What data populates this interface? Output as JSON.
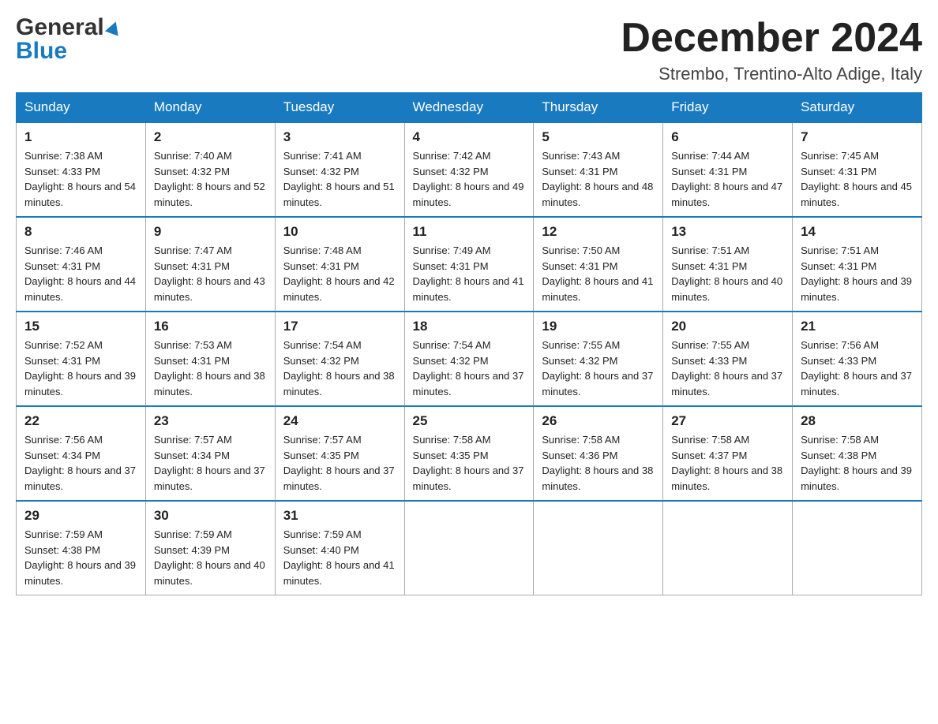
{
  "header": {
    "logo_general": "General",
    "logo_blue": "Blue",
    "month_title": "December 2024",
    "location": "Strembo, Trentino-Alto Adige, Italy"
  },
  "days_of_week": [
    "Sunday",
    "Monday",
    "Tuesday",
    "Wednesday",
    "Thursday",
    "Friday",
    "Saturday"
  ],
  "weeks": [
    [
      {
        "day": "1",
        "sunrise": "7:38 AM",
        "sunset": "4:33 PM",
        "daylight": "8 hours and 54 minutes."
      },
      {
        "day": "2",
        "sunrise": "7:40 AM",
        "sunset": "4:32 PM",
        "daylight": "8 hours and 52 minutes."
      },
      {
        "day": "3",
        "sunrise": "7:41 AM",
        "sunset": "4:32 PM",
        "daylight": "8 hours and 51 minutes."
      },
      {
        "day": "4",
        "sunrise": "7:42 AM",
        "sunset": "4:32 PM",
        "daylight": "8 hours and 49 minutes."
      },
      {
        "day": "5",
        "sunrise": "7:43 AM",
        "sunset": "4:31 PM",
        "daylight": "8 hours and 48 minutes."
      },
      {
        "day": "6",
        "sunrise": "7:44 AM",
        "sunset": "4:31 PM",
        "daylight": "8 hours and 47 minutes."
      },
      {
        "day": "7",
        "sunrise": "7:45 AM",
        "sunset": "4:31 PM",
        "daylight": "8 hours and 45 minutes."
      }
    ],
    [
      {
        "day": "8",
        "sunrise": "7:46 AM",
        "sunset": "4:31 PM",
        "daylight": "8 hours and 44 minutes."
      },
      {
        "day": "9",
        "sunrise": "7:47 AM",
        "sunset": "4:31 PM",
        "daylight": "8 hours and 43 minutes."
      },
      {
        "day": "10",
        "sunrise": "7:48 AM",
        "sunset": "4:31 PM",
        "daylight": "8 hours and 42 minutes."
      },
      {
        "day": "11",
        "sunrise": "7:49 AM",
        "sunset": "4:31 PM",
        "daylight": "8 hours and 41 minutes."
      },
      {
        "day": "12",
        "sunrise": "7:50 AM",
        "sunset": "4:31 PM",
        "daylight": "8 hours and 41 minutes."
      },
      {
        "day": "13",
        "sunrise": "7:51 AM",
        "sunset": "4:31 PM",
        "daylight": "8 hours and 40 minutes."
      },
      {
        "day": "14",
        "sunrise": "7:51 AM",
        "sunset": "4:31 PM",
        "daylight": "8 hours and 39 minutes."
      }
    ],
    [
      {
        "day": "15",
        "sunrise": "7:52 AM",
        "sunset": "4:31 PM",
        "daylight": "8 hours and 39 minutes."
      },
      {
        "day": "16",
        "sunrise": "7:53 AM",
        "sunset": "4:31 PM",
        "daylight": "8 hours and 38 minutes."
      },
      {
        "day": "17",
        "sunrise": "7:54 AM",
        "sunset": "4:32 PM",
        "daylight": "8 hours and 38 minutes."
      },
      {
        "day": "18",
        "sunrise": "7:54 AM",
        "sunset": "4:32 PM",
        "daylight": "8 hours and 37 minutes."
      },
      {
        "day": "19",
        "sunrise": "7:55 AM",
        "sunset": "4:32 PM",
        "daylight": "8 hours and 37 minutes."
      },
      {
        "day": "20",
        "sunrise": "7:55 AM",
        "sunset": "4:33 PM",
        "daylight": "8 hours and 37 minutes."
      },
      {
        "day": "21",
        "sunrise": "7:56 AM",
        "sunset": "4:33 PM",
        "daylight": "8 hours and 37 minutes."
      }
    ],
    [
      {
        "day": "22",
        "sunrise": "7:56 AM",
        "sunset": "4:34 PM",
        "daylight": "8 hours and 37 minutes."
      },
      {
        "day": "23",
        "sunrise": "7:57 AM",
        "sunset": "4:34 PM",
        "daylight": "8 hours and 37 minutes."
      },
      {
        "day": "24",
        "sunrise": "7:57 AM",
        "sunset": "4:35 PM",
        "daylight": "8 hours and 37 minutes."
      },
      {
        "day": "25",
        "sunrise": "7:58 AM",
        "sunset": "4:35 PM",
        "daylight": "8 hours and 37 minutes."
      },
      {
        "day": "26",
        "sunrise": "7:58 AM",
        "sunset": "4:36 PM",
        "daylight": "8 hours and 38 minutes."
      },
      {
        "day": "27",
        "sunrise": "7:58 AM",
        "sunset": "4:37 PM",
        "daylight": "8 hours and 38 minutes."
      },
      {
        "day": "28",
        "sunrise": "7:58 AM",
        "sunset": "4:38 PM",
        "daylight": "8 hours and 39 minutes."
      }
    ],
    [
      {
        "day": "29",
        "sunrise": "7:59 AM",
        "sunset": "4:38 PM",
        "daylight": "8 hours and 39 minutes."
      },
      {
        "day": "30",
        "sunrise": "7:59 AM",
        "sunset": "4:39 PM",
        "daylight": "8 hours and 40 minutes."
      },
      {
        "day": "31",
        "sunrise": "7:59 AM",
        "sunset": "4:40 PM",
        "daylight": "8 hours and 41 minutes."
      },
      null,
      null,
      null,
      null
    ]
  ],
  "labels": {
    "sunrise": "Sunrise:",
    "sunset": "Sunset:",
    "daylight": "Daylight:"
  }
}
